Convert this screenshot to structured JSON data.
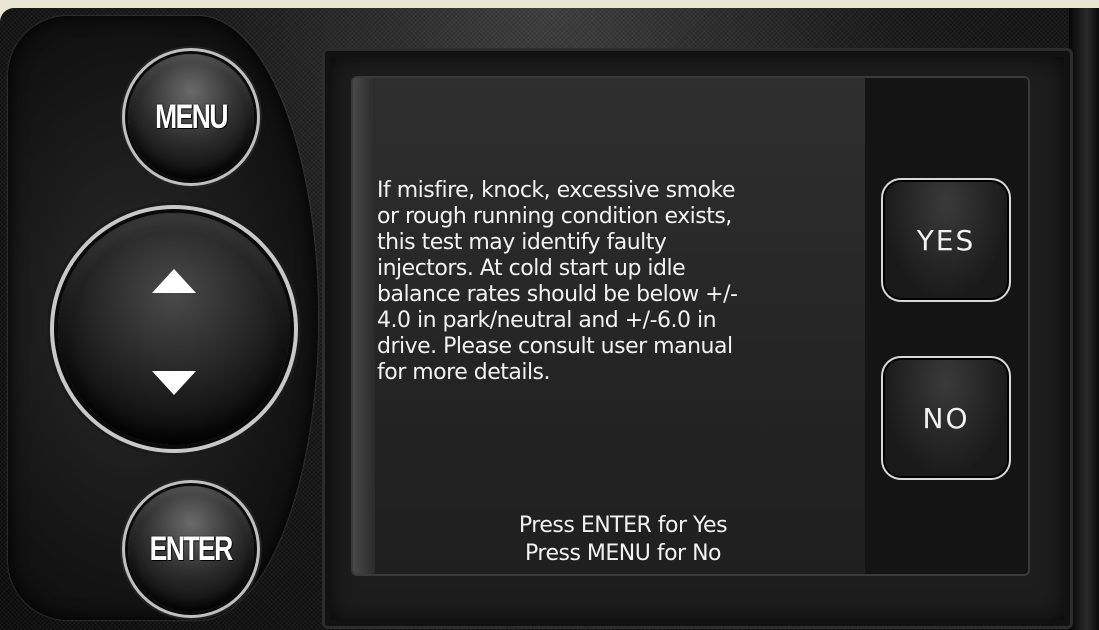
{
  "buttons": {
    "menu_label": "MENU",
    "enter_label": "ENTER",
    "up_icon": "triangle-up-icon",
    "down_icon": "triangle-down-icon"
  },
  "screen": {
    "message": "If misfire, knock, excessive smoke\nor rough running condition exists,\nthis test may identify faulty\ninjectors. At cold start up idle\nbalance rates should be below +/-\n4.0 in park/neutral and +/-6.0 in\ndrive. Please consult user manual\nfor more details.",
    "prompt_yes": "Press ENTER for Yes",
    "prompt_no": "Press MENU for No",
    "yes_label": "YES",
    "no_label": "NO"
  },
  "colors": {
    "background": "#e9e6d4",
    "device_body": "#161616",
    "screen": "#2a2a2a",
    "text": "#f2f2f2"
  }
}
